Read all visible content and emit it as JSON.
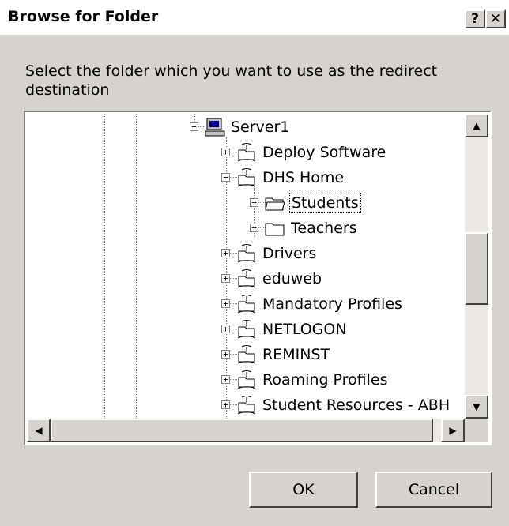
{
  "dialog": {
    "title": "Browse for Folder",
    "help_label": "?",
    "close_label": "✕",
    "prompt": "Select the folder which you want to use as the redirect destination"
  },
  "tree": {
    "root": {
      "label": "Server1",
      "icon": "server-computer-icon",
      "expander": "−"
    },
    "items": [
      {
        "label": "Deploy Software",
        "icon": "shared-folder-icon",
        "expander": "+"
      },
      {
        "label": "DHS Home",
        "icon": "shared-folder-icon",
        "expander": "−"
      },
      {
        "label": "Students",
        "icon": "open-folder-icon",
        "expander": "+",
        "selected": true
      },
      {
        "label": "Teachers",
        "icon": "folder-icon",
        "expander": "+"
      },
      {
        "label": "Drivers",
        "icon": "shared-folder-icon",
        "expander": "+"
      },
      {
        "label": "eduweb",
        "icon": "shared-folder-icon",
        "expander": "+"
      },
      {
        "label": "Mandatory Profiles",
        "icon": "shared-folder-icon",
        "expander": "+"
      },
      {
        "label": "NETLOGON",
        "icon": "shared-folder-icon",
        "expander": "+"
      },
      {
        "label": "REMINST",
        "icon": "shared-folder-icon",
        "expander": "+"
      },
      {
        "label": "Roaming Profiles",
        "icon": "shared-folder-icon",
        "expander": "+"
      },
      {
        "label": "Student Resources - ABH",
        "icon": "shared-folder-icon",
        "expander": "+"
      }
    ]
  },
  "buttons": {
    "ok_label": "OK",
    "cancel_label": "Cancel"
  },
  "colors": {
    "dialog_bg": "#d6d3ce",
    "tree_bg": "#ffffff"
  }
}
